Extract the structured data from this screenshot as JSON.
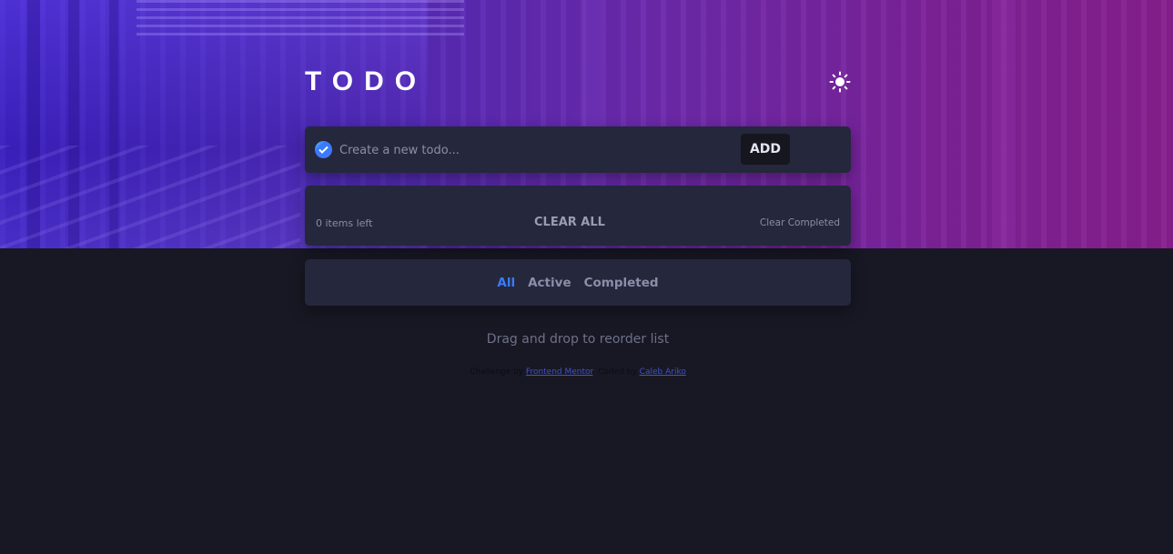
{
  "header": {
    "title": "TODO",
    "theme_toggle_icon": "sun-icon"
  },
  "new_todo": {
    "placeholder": "Create a new todo...",
    "value": "",
    "check_icon": "check-circle-icon",
    "add_label": "ADD"
  },
  "list": {
    "items": [],
    "items_left": "0 items left",
    "clear_all_label": "CLEAR ALL",
    "clear_completed_label": "Clear Completed"
  },
  "filters": {
    "items": [
      {
        "label": "All",
        "active": true
      },
      {
        "label": "Active",
        "active": false
      },
      {
        "label": "Completed",
        "active": false
      }
    ]
  },
  "hint": "Drag and drop to reorder list",
  "attribution": {
    "prefix": "Challenge by ",
    "link1": "Frontend Mentor",
    "middle": ". Coded by ",
    "link2": "Caleb Ariko"
  },
  "colors": {
    "accent": "#3a7bfd",
    "background": "#181824",
    "panel": "#25273c",
    "gradient_start": "#3a1fb8",
    "gradient_end": "#86208a"
  }
}
